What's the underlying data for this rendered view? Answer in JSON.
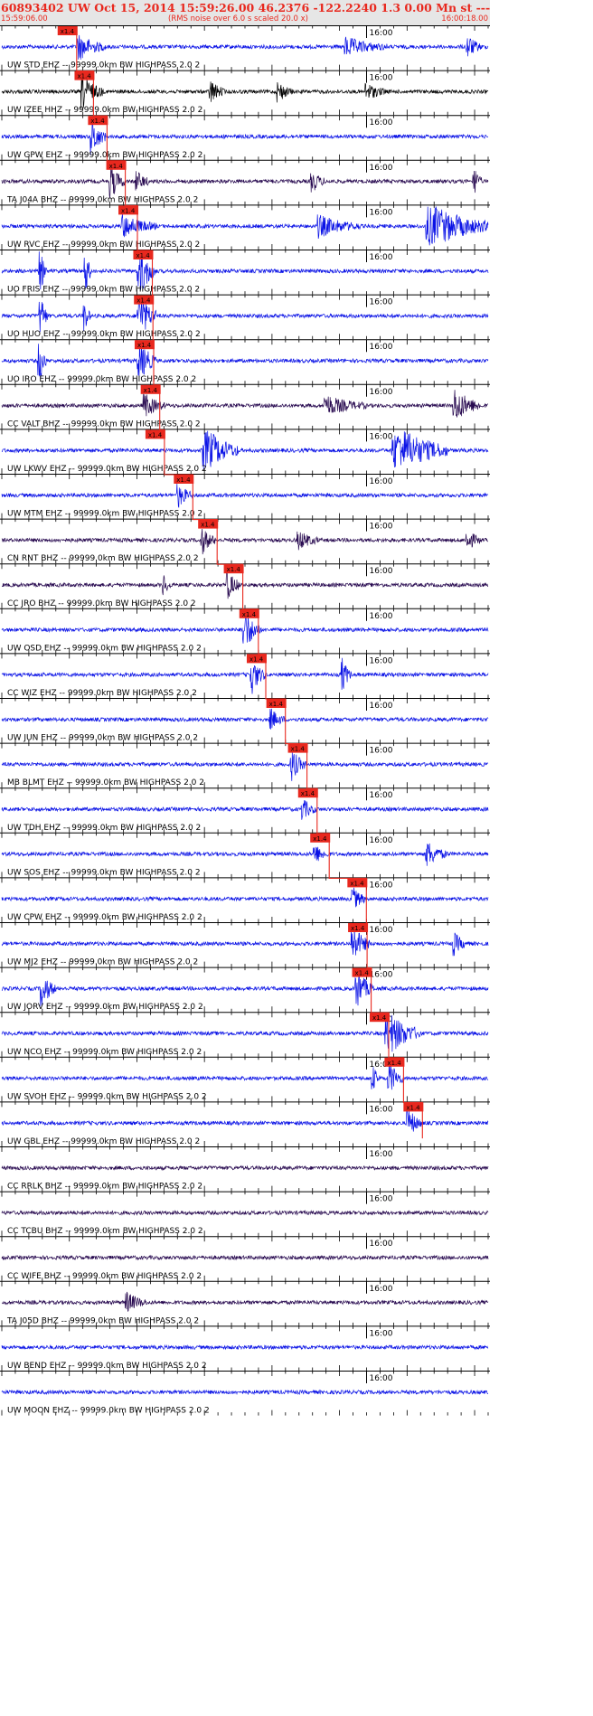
{
  "header": {
    "title": "60893402 UW Oct 15, 2014 15:59:26.00   46.2376 -122.2240  1.3 0.00 Mn st --- -- --   -1",
    "start_time": "15:59:06.00",
    "note": "(RMS noise over 6.0 s scaled 20.0 x)",
    "end_time": "16:00:18.00"
  },
  "colors": {
    "trace_blue": "#0a12e6",
    "trace_black": "#000000",
    "trace_navy": "#280a50",
    "pick_red": "#e8281e",
    "header_bg": "#e6e6e6",
    "header_text": "#e8281e"
  },
  "chart_data": {
    "type": "line",
    "title": "60893402 UW Oct 15, 2014 15:59:26.00   46.2376 -122.2240  1.3 0.00 Mn st --- -- --   -1",
    "x_range": [
      "15:59:06.00",
      "16:00:18.00"
    ],
    "minute_tick_label": "16:00",
    "pick_label": "x1.4",
    "grid": false,
    "traces": [
      {
        "label": "UW STD EHZ -- 99999.0km BW  HIGHPASS  2.0  2",
        "color": "#0a12e6",
        "pick_s": 8.4,
        "bursts": [
          [
            11.4,
            4,
            1.7
          ],
          [
            51,
            6,
            1.2
          ],
          [
            69,
            2,
            1.5
          ]
        ]
      },
      {
        "label": "UW IZEE HHZ -- 99999.0km BW  HIGHPASS  2.0  2",
        "color": "#000000",
        "pick_s": 10.9,
        "bursts": [
          [
            12,
            3,
            2.3
          ],
          [
            31,
            2,
            1.5
          ],
          [
            41,
            2,
            1.3
          ],
          [
            54,
            3,
            1.1
          ]
        ]
      },
      {
        "label": "UW GPW EHZ -- 99999.0km BW  HIGHPASS  2.0  2",
        "color": "#0a12e6",
        "pick_s": 12.9,
        "bursts": [
          [
            13.4,
            2,
            2.4
          ]
        ]
      },
      {
        "label": "TA J04A BHZ -- 99999.0km BW  HIGHPASS  2.0  2",
        "color": "#280a50",
        "pick_s": 15.6,
        "bursts": [
          [
            16.2,
            2,
            2.3
          ],
          [
            20,
            2,
            1.3
          ],
          [
            46,
            2,
            1.3
          ],
          [
            70,
            1,
            2
          ]
        ]
      },
      {
        "label": "UW RVC EHZ -- 99999.0km BW  HIGHPASS  2.0  2",
        "color": "#0a12e6",
        "pick_s": 17.4,
        "bursts": [
          [
            17.9,
            5,
            1.5
          ],
          [
            47,
            6,
            1.4
          ],
          [
            63,
            9,
            3.3
          ]
        ]
      },
      {
        "label": "UO FRIS EHZ -- 99999.0km BW  HIGHPASS  2.0  2",
        "color": "#0a12e6",
        "pick_s": 19.6,
        "bursts": [
          [
            5.6,
            1,
            3.5
          ],
          [
            12.5,
            0.8,
            2.8
          ],
          [
            20.3,
            2.5,
            4
          ]
        ]
      },
      {
        "label": "UO HUO EHZ -- 99999.0km BW  HIGHPASS  2.0  2",
        "color": "#0a12e6",
        "pick_s": 19.7,
        "bursts": [
          [
            5.8,
            1,
            3
          ],
          [
            12.3,
            0.8,
            2.2
          ],
          [
            20.3,
            2.5,
            3.5
          ]
        ]
      },
      {
        "label": "UO IRO EHZ -- 99999.0km BW  HIGHPASS  2.0  2",
        "color": "#0a12e6",
        "pick_s": 19.8,
        "bursts": [
          [
            5.6,
            1,
            3
          ],
          [
            20.3,
            2.5,
            3
          ]
        ]
      },
      {
        "label": "CC VALT BHZ -- 99999.0km BW  HIGHPASS  2.0  2",
        "color": "#280a50",
        "pick_s": 20.7,
        "bursts": [
          [
            21.2,
            3,
            1.5
          ],
          [
            48,
            6,
            1.3
          ],
          [
            67,
            4,
            2.3
          ]
        ]
      },
      {
        "label": "UW LKWV EHZ -- 99999.0km BW  HIGHPASS  2.0  2",
        "color": "#0a12e6",
        "pick_s": 21.4,
        "bursts": [
          [
            30,
            5,
            3.3
          ],
          [
            58,
            8,
            3.8
          ]
        ]
      },
      {
        "label": "UW MTM EHZ -- 99999.0km BW  HIGHPASS  2.0  2",
        "color": "#0a12e6",
        "pick_s": 25.6,
        "bursts": [
          [
            26.2,
            2,
            1.5
          ]
        ]
      },
      {
        "label": "CN RNT BHZ -- 99999.0km BW  HIGHPASS  2.0  2",
        "color": "#280a50",
        "pick_s": 29.2,
        "bursts": [
          [
            29.7,
            2,
            1.7
          ],
          [
            44,
            3,
            1.2
          ],
          [
            69,
            2,
            1.3
          ]
        ]
      },
      {
        "label": "CC JRO BHZ -- 99999.0km BW  HIGHPASS  2.0  2",
        "color": "#280a50",
        "pick_s": 33.0,
        "bursts": [
          [
            33.5,
            2,
            1.8
          ],
          [
            24,
            1,
            1.3
          ]
        ]
      },
      {
        "label": "UW OSD EHZ -- 99999.0km BW  HIGHPASS  2.0  2",
        "color": "#0a12e6",
        "pick_s": 35.3,
        "bursts": [
          [
            35.8,
            2.5,
            3.2
          ]
        ]
      },
      {
        "label": "CC WIZ EHZ -- 99999.0km BW  HIGHPASS  2.0  2",
        "color": "#0a12e6",
        "pick_s": 36.4,
        "bursts": [
          [
            37,
            2,
            2.5
          ],
          [
            50.5,
            1.2,
            2.2
          ]
        ]
      },
      {
        "label": "UW JUN EHZ -- 99999.0km BW  HIGHPASS  2.0  2",
        "color": "#0a12e6",
        "pick_s": 39.3,
        "bursts": [
          [
            39.9,
            2,
            1.3
          ]
        ]
      },
      {
        "label": "MB BLMT EHZ -- 99999.0km BW  HIGHPASS  2.0  2",
        "color": "#0a12e6",
        "pick_s": 42.5,
        "bursts": [
          [
            43,
            2,
            2
          ]
        ]
      },
      {
        "label": "UW TDH EHZ -- 99999.0km BW  HIGHPASS  2.0  2",
        "color": "#0a12e6",
        "pick_s": 44.0,
        "bursts": [
          [
            44.6,
            2,
            1.3
          ]
        ]
      },
      {
        "label": "UW SOS EHZ -- 99999.0km BW  HIGHPASS  2.0  2",
        "color": "#0a12e6",
        "pick_s": 45.8,
        "bursts": [
          [
            46.4,
            2,
            1.2
          ],
          [
            63,
            3,
            1.6
          ]
        ]
      },
      {
        "label": "UW CPW EHZ -- 99999.0km BW  HIGHPASS  2.0  2",
        "color": "#0a12e6",
        "pick_s": 51.3,
        "bursts": [
          [
            51.9,
            2,
            1.6
          ]
        ]
      },
      {
        "label": "UW MJ2 EHZ -- 99999.0km BW  HIGHPASS  2.0  2",
        "color": "#0a12e6",
        "pick_s": 51.4,
        "bursts": [
          [
            52,
            2.5,
            2.5
          ],
          [
            67,
            2,
            1.4
          ]
        ]
      },
      {
        "label": "UW JORV EHZ -- 99999.0km BW  HIGHPASS  2.0  2",
        "color": "#0a12e6",
        "pick_s": 52.0,
        "bursts": [
          [
            6,
            2,
            2.3
          ],
          [
            52.6,
            2.5,
            2.6
          ]
        ]
      },
      {
        "label": "UW NCO EHZ -- 99999.0km BW  HIGHPASS  2.0  2",
        "color": "#0a12e6",
        "pick_s": 54.6,
        "bursts": [
          [
            57,
            5,
            3.2
          ]
        ]
      },
      {
        "label": "UW SVOH EHZ -- 99999.0km BW  HIGHPASS  2.0  2",
        "color": "#0a12e6",
        "pick_s": 56.8,
        "bursts": [
          [
            57.4,
            2,
            2.3
          ],
          [
            55,
            1,
            1.5
          ]
        ]
      },
      {
        "label": "UW GBL EHZ -- 99999.0km BW  HIGHPASS  2.0  2",
        "color": "#0a12e6",
        "pick_s": 59.6,
        "bursts": [
          [
            60.2,
            2,
            2
          ]
        ]
      },
      {
        "label": "CC RRLK BHZ -- 99999.0km BW  HIGHPASS  2.0  2",
        "color": "#280a50",
        "pick_s": null,
        "bursts": []
      },
      {
        "label": "CC TCBU BHZ -- 99999.0km BW  HIGHPASS  2.0  2",
        "color": "#280a50",
        "pick_s": null,
        "bursts": []
      },
      {
        "label": "CC WIFE BHZ -- 99999.0km BW  HIGHPASS  2.0  2",
        "color": "#280a50",
        "pick_s": null,
        "bursts": []
      },
      {
        "label": "TA J05D BHZ -- 99999.0km BW  HIGHPASS  2.0  2",
        "color": "#280a50",
        "pick_s": null,
        "bursts": [
          [
            18.5,
            3,
            1.3
          ]
        ]
      },
      {
        "label": "UW BEND EHZ -- 99999.0km BW  HIGHPASS  2.0  2",
        "color": "#0a12e6",
        "pick_s": null,
        "bursts": []
      },
      {
        "label": "UW MOON EHZ -- 99999.0km BW  HIGHPASS  2.0  2",
        "color": "#0a12e6",
        "pick_s": null,
        "bursts": []
      }
    ]
  }
}
